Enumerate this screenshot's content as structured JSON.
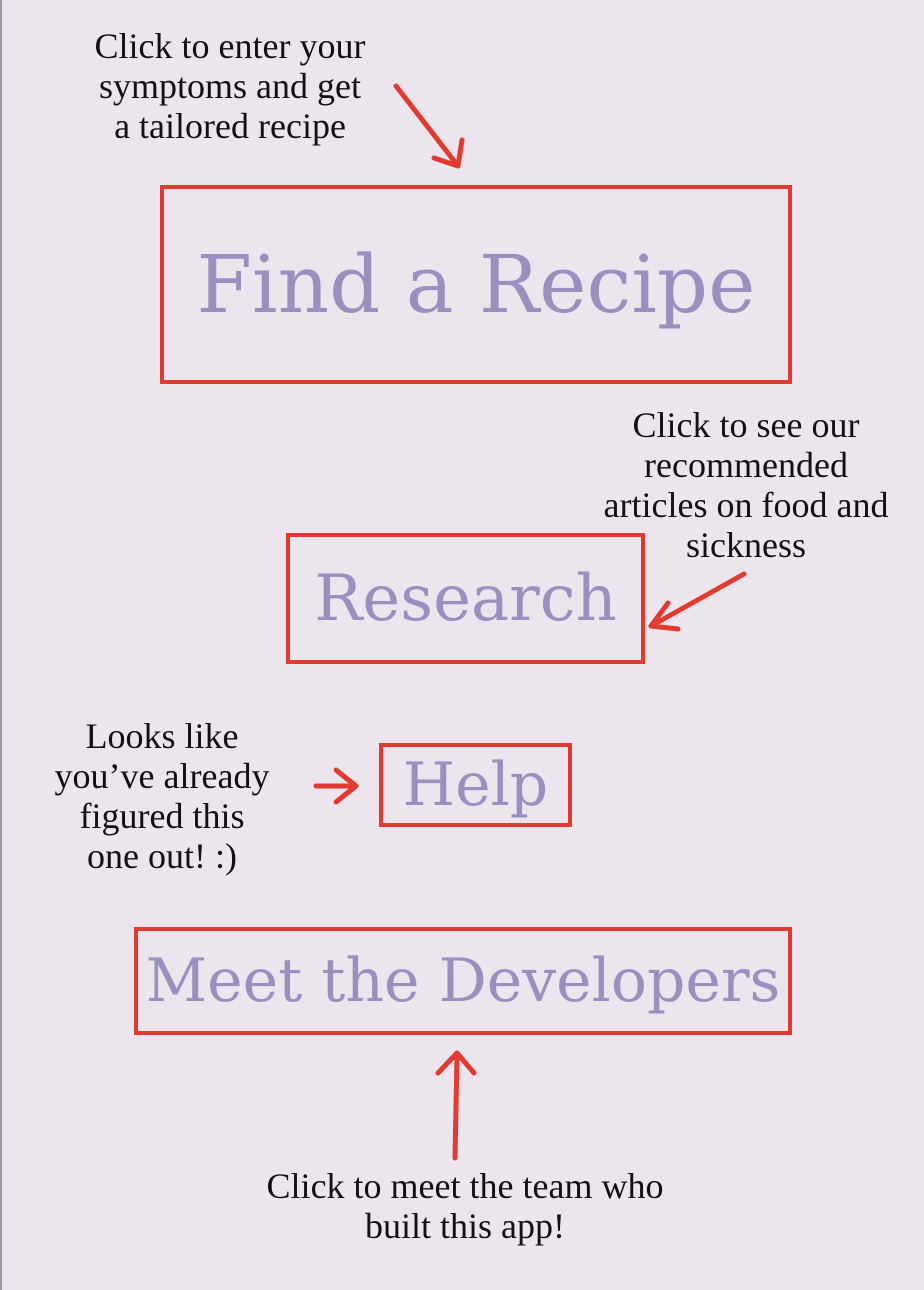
{
  "buttons": {
    "find_recipe": "Find a Recipe",
    "research": "Research",
    "help": "Help",
    "meet_developers": "Meet the Developers"
  },
  "annotations": {
    "find_recipe": "Click to enter your\nsymptoms and get\na tailored recipe",
    "research": "Click to see our\nrecommended\narticles on food and\nsickness",
    "help": "Looks like\nyou’ve already\nfigured this\none out!  :)",
    "meet_developers": "Click to meet the team who\nbuilt this app!"
  },
  "colors": {
    "background": "#ede5ee",
    "border_red": "#e23a2e",
    "button_text": "#9a90c0",
    "annotation_text": "#111111"
  },
  "icons": {
    "arrow": "arrow-icon"
  }
}
